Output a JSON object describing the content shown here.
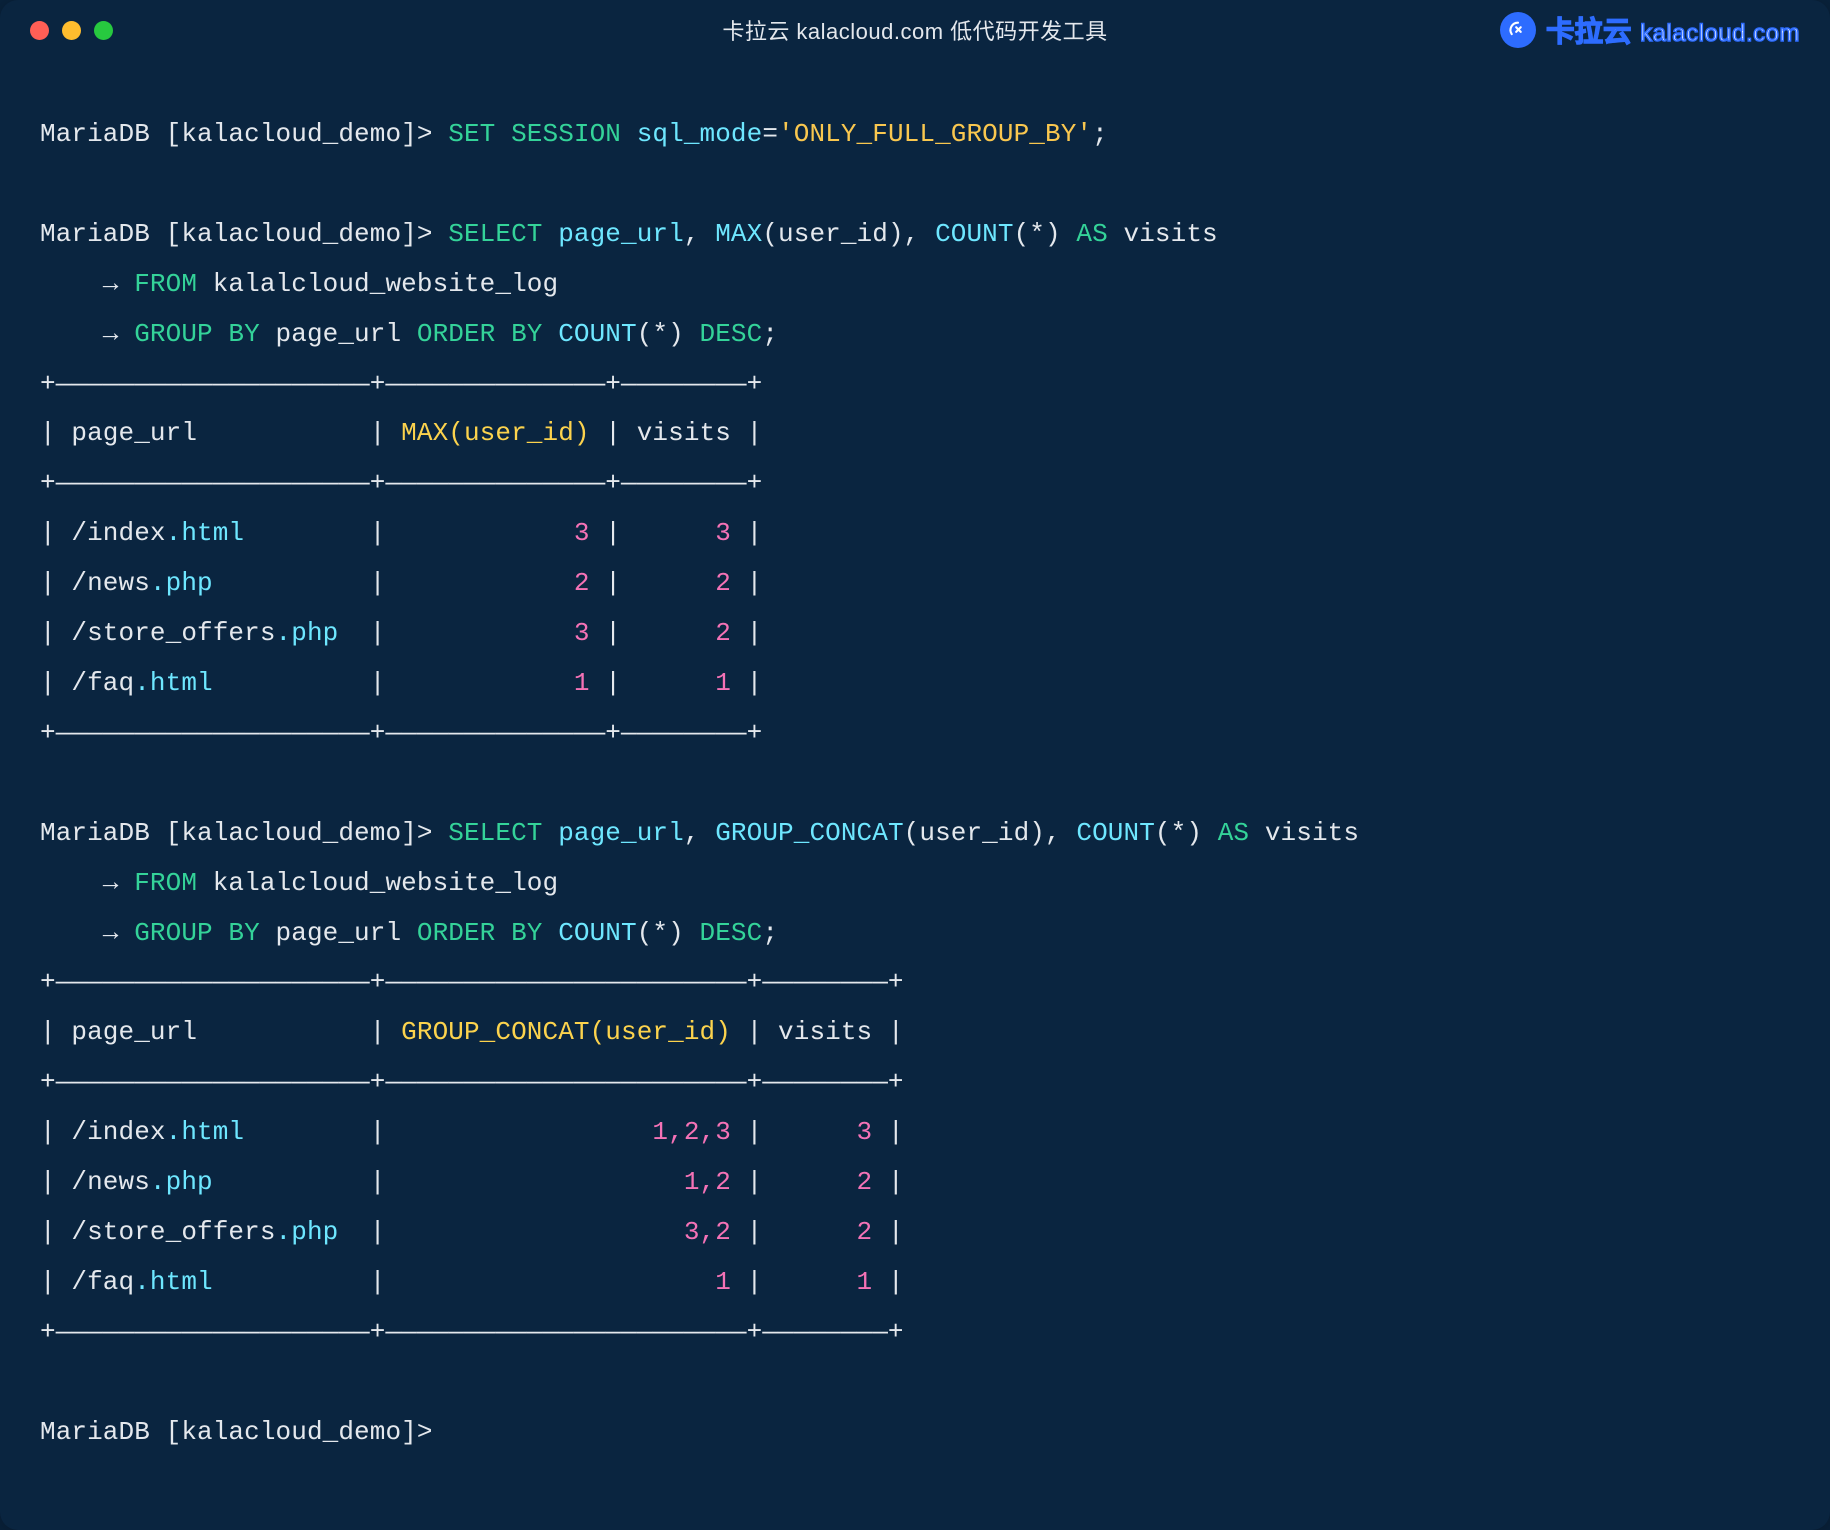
{
  "title": "卡拉云 kalacloud.com 低代码开发工具",
  "brand": {
    "name": "卡拉云",
    "domain": "kalacloud.com"
  },
  "prompt": "MariaDB [kalacloud_demo]>",
  "arrow": "→",
  "stmt1": {
    "keyword1": "SET SESSION",
    "ident": "sql_mode",
    "eq": "=",
    "string": "'ONLY_FULL_GROUP_BY'",
    "semi": ";"
  },
  "stmt2": {
    "select_kw": "SELECT",
    "col1": "page_url",
    "comma1": ", ",
    "max_fn": "MAX",
    "max_arg": "(user_id)",
    "comma2": ", ",
    "count_fn": "COUNT",
    "count_arg": "(*) ",
    "as_kw": "AS",
    "alias": " visits",
    "from_kw": "FROM",
    "table": " kalalcloud_website_log",
    "group_kw": "GROUP BY",
    "group_col": " page_url ",
    "order_kw": "ORDER BY",
    "order_fn": " COUNT",
    "order_arg": "(*) ",
    "desc_kw": "DESC",
    "semi": ";"
  },
  "table1": {
    "sep": "+--------------------+---------------+---------+",
    "header": "| page_url           | MAX(user_id) | visits |",
    "rows": [
      {
        "url_pre": "/index",
        "url_suf": ".html",
        "c2": "3",
        "c3": "3"
      },
      {
        "url_pre": "/news",
        "url_suf": ".php",
        "c2": "2",
        "c3": "2"
      },
      {
        "url_pre": "/store_offers",
        "url_suf": ".php",
        "c2": "3",
        "c3": "2"
      },
      {
        "url_pre": "/faq",
        "url_suf": ".html",
        "c2": "1",
        "c3": "1"
      }
    ],
    "col1_inner": 18,
    "col2_inner": 12,
    "col3_inner": 6
  },
  "stmt3": {
    "select_kw": "SELECT",
    "col1": "page_url",
    "comma1": ", ",
    "gc_fn": "GROUP_CONCAT",
    "gc_arg": "(user_id)",
    "comma2": ", ",
    "count_fn": "COUNT",
    "count_arg": "(*) ",
    "as_kw": "AS",
    "alias": " visits",
    "from_kw": "FROM",
    "table": " kalalcloud_website_log",
    "group_kw": "GROUP BY",
    "group_col": " page_url ",
    "order_kw": "ORDER BY",
    "order_fn": " COUNT",
    "order_arg": "(*) ",
    "desc_kw": "DESC",
    "semi": ";"
  },
  "table2": {
    "sep": "+--------------------+------------------------+---------+",
    "header": "| page_url           | GROUP_CONCAT(user_id) | visits |",
    "rows": [
      {
        "url_pre": "/index",
        "url_suf": ".html",
        "c2": "1,2,3",
        "c3": "3"
      },
      {
        "url_pre": "/news",
        "url_suf": ".php",
        "c2": "1,2",
        "c3": "2"
      },
      {
        "url_pre": "/store_offers",
        "url_suf": ".php",
        "c2": "3,2",
        "c3": "2"
      },
      {
        "url_pre": "/faq",
        "url_suf": ".html",
        "c2": "1",
        "c3": "1"
      }
    ],
    "col1_inner": 18,
    "col2_inner": 21,
    "col3_inner": 6
  }
}
